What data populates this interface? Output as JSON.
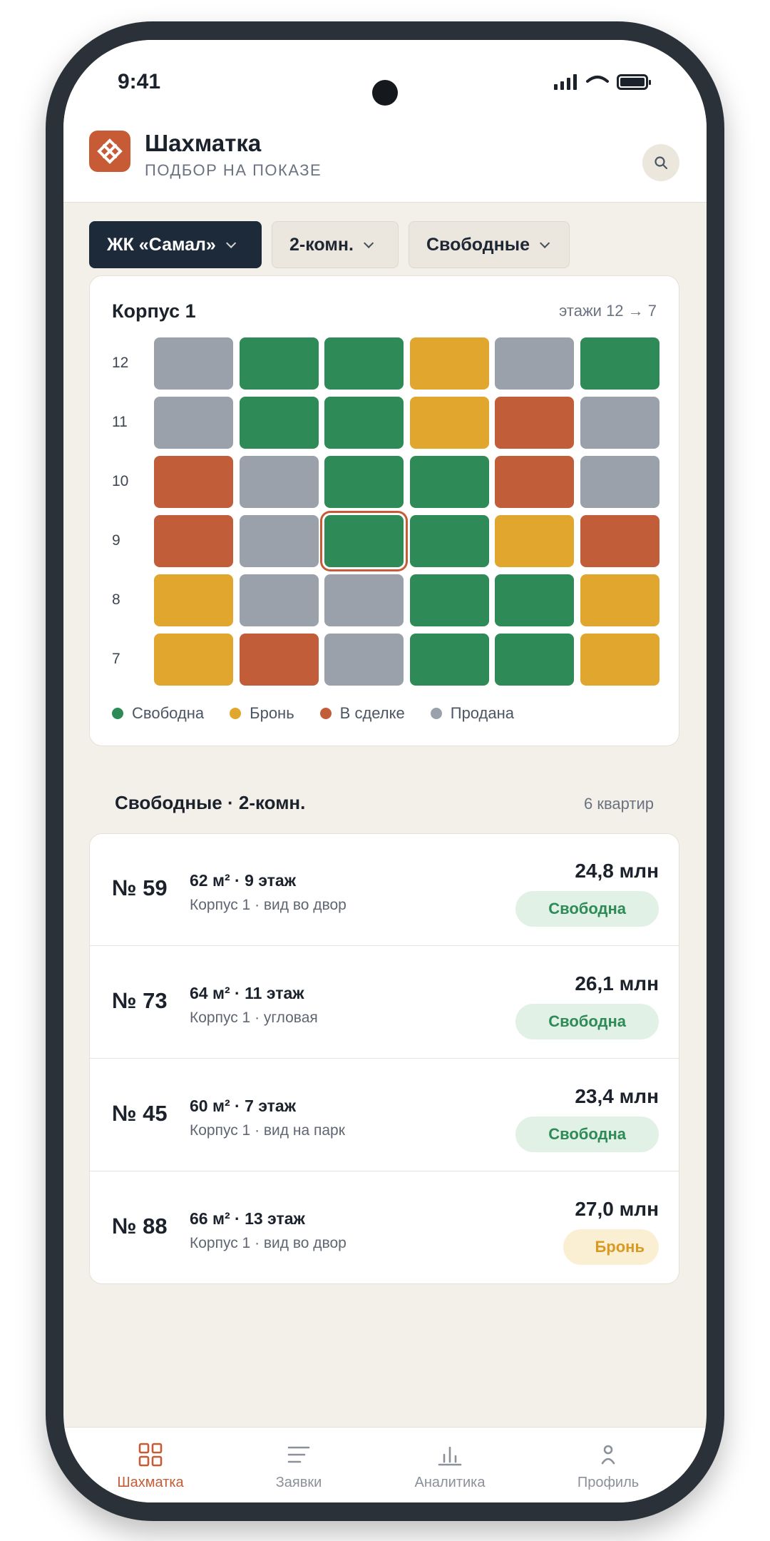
{
  "status_bar": {
    "time": "9:41"
  },
  "header": {
    "title": "Шахматка",
    "subtitle": "ПОДБОР НА ПОКАЗЕ"
  },
  "filters": [
    {
      "label": "ЖК «Самал»"
    },
    {
      "label": "2-комн."
    },
    {
      "label": "Свободные"
    }
  ],
  "colors": {
    "free": "#2e8b57",
    "reserve": "#e0a62e",
    "deal": "#c25d3a",
    "sold": "#9aa1aa",
    "accent": "#c75b36",
    "dark": "#1c2a3a"
  },
  "building": {
    "title": "Корпус 1",
    "floors_label": "этажи 12 → 7",
    "floors": [
      {
        "floor": "12",
        "units": [
          "sold",
          "free",
          "free",
          "reserve",
          "sold",
          "free"
        ]
      },
      {
        "floor": "11",
        "units": [
          "sold",
          "free",
          "free",
          "reserve",
          "deal",
          "sold"
        ]
      },
      {
        "floor": "10",
        "units": [
          "deal",
          "sold",
          "free",
          "free",
          "deal",
          "sold"
        ]
      },
      {
        "floor": "9",
        "units": [
          "deal",
          "sold",
          "free",
          "free",
          "reserve",
          "deal"
        ],
        "selected_index": 2
      },
      {
        "floor": "8",
        "units": [
          "reserve",
          "sold",
          "sold",
          "free",
          "free",
          "reserve"
        ]
      },
      {
        "floor": "7",
        "units": [
          "reserve",
          "deal",
          "sold",
          "free",
          "free",
          "reserve"
        ]
      }
    ],
    "legend": [
      {
        "label": "Свободна",
        "status": "free"
      },
      {
        "label": "Бронь",
        "status": "reserve"
      },
      {
        "label": "В сделке",
        "status": "deal"
      },
      {
        "label": "Продана",
        "status": "sold"
      }
    ]
  },
  "list": {
    "title": "Свободные · 2-комн.",
    "count": "6 квартир",
    "items": [
      {
        "number": "№ 59",
        "spec": "62 м² · 9 этаж",
        "desc": "Корпус 1 · вид во двор",
        "price": "24,8 млн",
        "status": "Свободна",
        "status_key": "free"
      },
      {
        "number": "№ 73",
        "spec": "64 м² · 11 этаж",
        "desc": "Корпус 1 · угловая",
        "price": "26,1 млн",
        "status": "Свободна",
        "status_key": "free"
      },
      {
        "number": "№ 45",
        "spec": "60 м² · 7 этаж",
        "desc": "Корпус 1 · вид на парк",
        "price": "23,4 млн",
        "status": "Свободна",
        "status_key": "free"
      },
      {
        "number": "№ 88",
        "spec": "66 м² · 13 этаж",
        "desc": "Корпус 1 · вид во двор",
        "price": "27,0 млн",
        "status": "Бронь",
        "status_key": "reserve"
      }
    ]
  },
  "nav": [
    {
      "label": "Шахматка",
      "icon": "grid-icon",
      "active": true
    },
    {
      "label": "Заявки",
      "icon": "list-icon",
      "active": false
    },
    {
      "label": "Аналитика",
      "icon": "chart-icon",
      "active": false
    },
    {
      "label": "Профиль",
      "icon": "user-icon",
      "active": false
    }
  ]
}
